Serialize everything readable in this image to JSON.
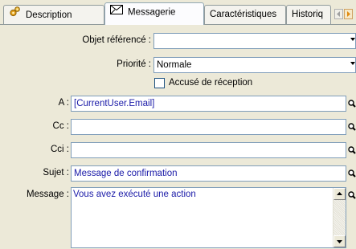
{
  "tabs": [
    {
      "label": "Description",
      "icon": "gears-icon"
    },
    {
      "label": "Messagerie",
      "icon": "envelope-icon"
    },
    {
      "label": "Caractéristiques"
    },
    {
      "label": "Historiq"
    }
  ],
  "form": {
    "objet": {
      "label": "Objet référencé :",
      "value": ""
    },
    "priorite": {
      "label": "Priorité :",
      "value": "Normale"
    },
    "accuse": {
      "label": "Accusé de réception",
      "checked": false
    },
    "a": {
      "label": "A :",
      "value": "[CurrentUser.Email]"
    },
    "cc": {
      "label": "Cc :",
      "value": ""
    },
    "cci": {
      "label": "Cci :",
      "value": ""
    },
    "sujet": {
      "label": "Sujet :",
      "value": "Message de confirmation"
    },
    "message": {
      "label": "Message :",
      "value": "Vous avez exécuté une action"
    }
  },
  "colors": {
    "value_text": "#1a1aa8",
    "background": "#ece9d8"
  }
}
